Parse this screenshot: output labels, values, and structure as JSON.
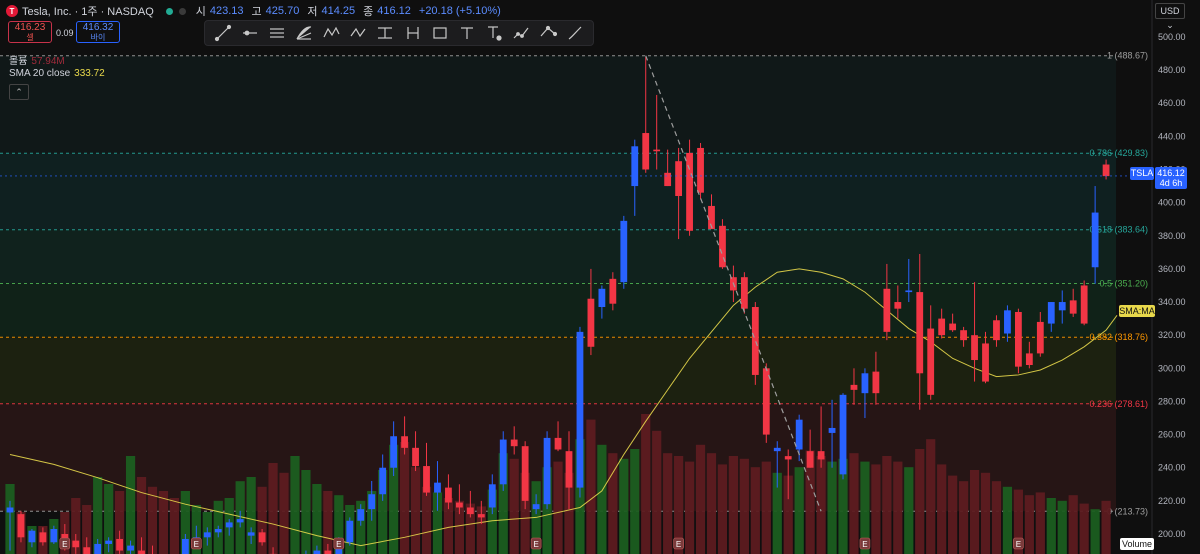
{
  "header": {
    "logo_letter": "T",
    "symbol": "Tesla, Inc. · 1주 · NASDAQ",
    "open_label": "시",
    "open": "423.13",
    "high_label": "고",
    "high": "425.70",
    "low_label": "저",
    "low": "414.25",
    "close_label": "종",
    "close": "416.12",
    "change": "+20.18 (+5.10%)",
    "sell_price": "416.23",
    "sell_label": "셀",
    "buy_price": "416.32",
    "buy_label": "바이",
    "spread": "0.09",
    "volume_label": "볼륨",
    "volume_value": "57.94M",
    "sma_label": "SMA 20 close",
    "sma_value": "333.72",
    "currency": "USD"
  },
  "toolbar": [
    "trend-line-icon",
    "ray-icon",
    "parallel-channel-icon",
    "fib-fan-icon",
    "xabcd-pattern-icon",
    "abcd-pattern-icon",
    "price-range-icon",
    "date-range-icon",
    "rectangle-icon",
    "text-icon",
    "anchored-note-icon",
    "projection-icon",
    "path-icon",
    "brush-icon"
  ],
  "price_tags": {
    "symbol_tag": "TSLA",
    "last_price": "416.12",
    "countdown": "4d 6h",
    "sma_tag": "SMA:MA",
    "volume_tag": "Volume"
  },
  "colors": {
    "up": "#2962ff",
    "down": "#f23645",
    "sma": "#e8d84b",
    "vol_up": "#1b5e20",
    "vol_down": "#5d1b20"
  },
  "chart_data": {
    "type": "candlestick",
    "interval": "1W",
    "ylim": [
      200,
      506
    ],
    "y_ticks": [
      200,
      220,
      240,
      260,
      280,
      300,
      320,
      340,
      360,
      380,
      400,
      420,
      440,
      460,
      480,
      500
    ],
    "fib_levels": [
      {
        "label": "1 (488.67)",
        "value": 488.67,
        "color": "#9e9e9e"
      },
      {
        "label": "0.786 (429.83)",
        "value": 429.83,
        "color": "#26a69a"
      },
      {
        "label": "0.618 (383.64)",
        "value": 383.64,
        "color": "#26a69a"
      },
      {
        "label": "0.5 (351.20)",
        "value": 351.2,
        "color": "#4caf50"
      },
      {
        "label": "0.382 (318.76)",
        "value": 318.76,
        "color": "#ff9800"
      },
      {
        "label": "0.236 (278.61)",
        "value": 278.61,
        "color": "#f23645"
      },
      {
        "label": "0 (213.73)",
        "value": 213.73,
        "color": "#9e9e9e"
      }
    ],
    "candles": [
      {
        "o": 213,
        "h": 220,
        "l": 190,
        "c": 216
      },
      {
        "o": 212,
        "h": 214,
        "l": 195,
        "c": 198
      },
      {
        "o": 195,
        "h": 203,
        "l": 192,
        "c": 202
      },
      {
        "o": 201,
        "h": 204,
        "l": 193,
        "c": 195
      },
      {
        "o": 195,
        "h": 205,
        "l": 194,
        "c": 203
      },
      {
        "o": 200,
        "h": 206,
        "l": 190,
        "c": 197
      },
      {
        "o": 196,
        "h": 200,
        "l": 188,
        "c": 192
      },
      {
        "o": 192,
        "h": 198,
        "l": 183,
        "c": 186
      },
      {
        "o": 187,
        "h": 197,
        "l": 184,
        "c": 194
      },
      {
        "o": 194,
        "h": 198,
        "l": 189,
        "c": 196
      },
      {
        "o": 197,
        "h": 202,
        "l": 188,
        "c": 190
      },
      {
        "o": 190,
        "h": 196,
        "l": 185,
        "c": 193
      },
      {
        "o": 190,
        "h": 198,
        "l": 182,
        "c": 185
      },
      {
        "o": 185,
        "h": 193,
        "l": 178,
        "c": 183
      },
      {
        "o": 183,
        "h": 187,
        "l": 179,
        "c": 180
      },
      {
        "o": 180,
        "h": 184,
        "l": 175,
        "c": 178
      },
      {
        "o": 186,
        "h": 200,
        "l": 182,
        "c": 197
      },
      {
        "o": 196,
        "h": 205,
        "l": 194,
        "c": 198
      },
      {
        "o": 198,
        "h": 204,
        "l": 193,
        "c": 201
      },
      {
        "o": 201,
        "h": 205,
        "l": 198,
        "c": 203
      },
      {
        "o": 204,
        "h": 209,
        "l": 199,
        "c": 207
      },
      {
        "o": 207,
        "h": 214,
        "l": 204,
        "c": 209
      },
      {
        "o": 199,
        "h": 204,
        "l": 194,
        "c": 201
      },
      {
        "o": 201,
        "h": 203,
        "l": 193,
        "c": 195
      },
      {
        "o": 188,
        "h": 192,
        "l": 178,
        "c": 181
      },
      {
        "o": 182,
        "h": 186,
        "l": 175,
        "c": 177
      },
      {
        "o": 180,
        "h": 187,
        "l": 176,
        "c": 184
      },
      {
        "o": 184,
        "h": 190,
        "l": 181,
        "c": 186
      },
      {
        "o": 186,
        "h": 193,
        "l": 183,
        "c": 190
      },
      {
        "o": 190,
        "h": 194,
        "l": 182,
        "c": 185
      },
      {
        "o": 186,
        "h": 198,
        "l": 183,
        "c": 195
      },
      {
        "o": 195,
        "h": 210,
        "l": 193,
        "c": 208
      },
      {
        "o": 208,
        "h": 218,
        "l": 205,
        "c": 215
      },
      {
        "o": 215,
        "h": 232,
        "l": 208,
        "c": 224
      },
      {
        "o": 224,
        "h": 248,
        "l": 220,
        "c": 240
      },
      {
        "o": 240,
        "h": 268,
        "l": 235,
        "c": 259
      },
      {
        "o": 259,
        "h": 271,
        "l": 248,
        "c": 252
      },
      {
        "o": 252,
        "h": 262,
        "l": 238,
        "c": 241
      },
      {
        "o": 241,
        "h": 255,
        "l": 223,
        "c": 225
      },
      {
        "o": 225,
        "h": 244,
        "l": 214,
        "c": 231
      },
      {
        "o": 228,
        "h": 236,
        "l": 215,
        "c": 219
      },
      {
        "o": 219,
        "h": 230,
        "l": 212,
        "c": 216
      },
      {
        "o": 216,
        "h": 226,
        "l": 210,
        "c": 212
      },
      {
        "o": 212,
        "h": 220,
        "l": 206,
        "c": 210
      },
      {
        "o": 216,
        "h": 236,
        "l": 212,
        "c": 230
      },
      {
        "o": 230,
        "h": 262,
        "l": 226,
        "c": 257
      },
      {
        "o": 257,
        "h": 265,
        "l": 248,
        "c": 253
      },
      {
        "o": 253,
        "h": 256,
        "l": 215,
        "c": 220
      },
      {
        "o": 215,
        "h": 224,
        "l": 212,
        "c": 218
      },
      {
        "o": 218,
        "h": 262,
        "l": 215,
        "c": 258
      },
      {
        "o": 258,
        "h": 268,
        "l": 250,
        "c": 251
      },
      {
        "o": 250,
        "h": 262,
        "l": 215,
        "c": 228
      },
      {
        "o": 228,
        "h": 325,
        "l": 222,
        "c": 322
      },
      {
        "o": 342,
        "h": 360,
        "l": 308,
        "c": 313
      },
      {
        "o": 337,
        "h": 350,
        "l": 330,
        "c": 348
      },
      {
        "o": 354,
        "h": 358,
        "l": 335,
        "c": 339
      },
      {
        "o": 352,
        "h": 392,
        "l": 348,
        "c": 389
      },
      {
        "o": 410,
        "h": 438,
        "l": 392,
        "c": 434
      },
      {
        "o": 442,
        "h": 488,
        "l": 418,
        "c": 420
      },
      {
        "o": 432,
        "h": 465,
        "l": 420,
        "c": 431
      },
      {
        "o": 418,
        "h": 432,
        "l": 410,
        "c": 410
      },
      {
        "o": 425,
        "h": 433,
        "l": 378,
        "c": 404
      },
      {
        "o": 430,
        "h": 438,
        "l": 380,
        "c": 383
      },
      {
        "o": 433,
        "h": 436,
        "l": 402,
        "c": 406
      },
      {
        "o": 398,
        "h": 405,
        "l": 385,
        "c": 384
      },
      {
        "o": 386,
        "h": 390,
        "l": 360,
        "c": 361
      },
      {
        "o": 355,
        "h": 362,
        "l": 340,
        "c": 347
      },
      {
        "o": 355,
        "h": 358,
        "l": 333,
        "c": 336
      },
      {
        "o": 337,
        "h": 340,
        "l": 290,
        "c": 296
      },
      {
        "o": 300,
        "h": 303,
        "l": 255,
        "c": 260
      },
      {
        "o": 250,
        "h": 256,
        "l": 228,
        "c": 252
      },
      {
        "o": 247,
        "h": 251,
        "l": 221,
        "c": 245
      },
      {
        "o": 251,
        "h": 272,
        "l": 244,
        "c": 269
      },
      {
        "o": 250,
        "h": 263,
        "l": 240,
        "c": 240
      },
      {
        "o": 250,
        "h": 277,
        "l": 240,
        "c": 245
      },
      {
        "o": 261,
        "h": 281,
        "l": 240,
        "c": 264
      },
      {
        "o": 236,
        "h": 285,
        "l": 233,
        "c": 284
      },
      {
        "o": 290,
        "h": 300,
        "l": 278,
        "c": 287
      },
      {
        "o": 285,
        "h": 300,
        "l": 270,
        "c": 297
      },
      {
        "o": 298,
        "h": 310,
        "l": 278,
        "c": 285
      },
      {
        "o": 348,
        "h": 363,
        "l": 317,
        "c": 322
      },
      {
        "o": 340,
        "h": 350,
        "l": 330,
        "c": 336
      },
      {
        "o": 346,
        "h": 366,
        "l": 340,
        "c": 347
      },
      {
        "o": 346,
        "h": 369,
        "l": 275,
        "c": 297
      },
      {
        "o": 324,
        "h": 338,
        "l": 281,
        "c": 284
      },
      {
        "o": 330,
        "h": 336,
        "l": 318,
        "c": 320
      },
      {
        "o": 327,
        "h": 333,
        "l": 322,
        "c": 323
      },
      {
        "o": 323,
        "h": 325,
        "l": 313,
        "c": 317
      },
      {
        "o": 320,
        "h": 352,
        "l": 292,
        "c": 305
      },
      {
        "o": 315,
        "h": 322,
        "l": 291,
        "c": 292
      },
      {
        "o": 329,
        "h": 332,
        "l": 313,
        "c": 317
      },
      {
        "o": 321,
        "h": 338,
        "l": 316,
        "c": 335
      },
      {
        "o": 334,
        "h": 336,
        "l": 297,
        "c": 301
      },
      {
        "o": 309,
        "h": 316,
        "l": 300,
        "c": 302
      },
      {
        "o": 328,
        "h": 334,
        "l": 307,
        "c": 309
      },
      {
        "o": 327,
        "h": 340,
        "l": 322,
        "c": 340
      },
      {
        "o": 335,
        "h": 347,
        "l": 327,
        "c": 340
      },
      {
        "o": 341,
        "h": 348,
        "l": 331,
        "c": 333
      },
      {
        "o": 350,
        "h": 353,
        "l": 326,
        "c": 327
      },
      {
        "o": 361,
        "h": 410,
        "l": 351,
        "c": 394
      },
      {
        "o": 423,
        "h": 426,
        "l": 414,
        "c": 416
      }
    ],
    "sma": [
      {
        "i": 0,
        "v": 248
      },
      {
        "i": 4,
        "v": 242
      },
      {
        "i": 8,
        "v": 234
      },
      {
        "i": 12,
        "v": 225
      },
      {
        "i": 16,
        "v": 218
      },
      {
        "i": 20,
        "v": 212
      },
      {
        "i": 24,
        "v": 206
      },
      {
        "i": 28,
        "v": 199
      },
      {
        "i": 32,
        "v": 193
      },
      {
        "i": 36,
        "v": 198
      },
      {
        "i": 40,
        "v": 204
      },
      {
        "i": 44,
        "v": 208
      },
      {
        "i": 48,
        "v": 210
      },
      {
        "i": 52,
        "v": 216
      },
      {
        "i": 54,
        "v": 226
      },
      {
        "i": 56,
        "v": 248
      },
      {
        "i": 58,
        "v": 268
      },
      {
        "i": 60,
        "v": 287
      },
      {
        "i": 62,
        "v": 306
      },
      {
        "i": 64,
        "v": 322
      },
      {
        "i": 66,
        "v": 338
      },
      {
        "i": 68,
        "v": 349
      },
      {
        "i": 70,
        "v": 358
      },
      {
        "i": 72,
        "v": 360
      },
      {
        "i": 74,
        "v": 358
      },
      {
        "i": 76,
        "v": 354
      },
      {
        "i": 78,
        "v": 346
      },
      {
        "i": 80,
        "v": 335
      },
      {
        "i": 82,
        "v": 324
      },
      {
        "i": 84,
        "v": 316
      },
      {
        "i": 86,
        "v": 306
      },
      {
        "i": 88,
        "v": 300
      },
      {
        "i": 90,
        "v": 295
      },
      {
        "i": 92,
        "v": 296
      },
      {
        "i": 94,
        "v": 299
      },
      {
        "i": 96,
        "v": 305
      },
      {
        "i": 98,
        "v": 313
      },
      {
        "i": 100,
        "v": 323
      },
      {
        "i": 101,
        "v": 332
      }
    ],
    "volume_rel": [
      0.5,
      0.3,
      0.2,
      0.2,
      0.25,
      0.3,
      0.4,
      0.35,
      0.55,
      0.5,
      0.45,
      0.7,
      0.55,
      0.48,
      0.45,
      0.4,
      0.45,
      0.35,
      0.3,
      0.38,
      0.4,
      0.52,
      0.55,
      0.48,
      0.65,
      0.58,
      0.7,
      0.6,
      0.5,
      0.45,
      0.42,
      0.35,
      0.38,
      0.45,
      0.6,
      0.78,
      0.8,
      0.62,
      0.48,
      0.44,
      0.4,
      0.38,
      0.36,
      0.34,
      0.46,
      0.72,
      0.68,
      0.58,
      0.52,
      0.62,
      0.66,
      0.58,
      0.82,
      0.96,
      0.78,
      0.72,
      0.68,
      0.75,
      1.0,
      0.88,
      0.72,
      0.7,
      0.66,
      0.78,
      0.72,
      0.64,
      0.7,
      0.68,
      0.62,
      0.66,
      0.58,
      0.56,
      0.62,
      0.74,
      0.7,
      0.66,
      0.68,
      0.72,
      0.66,
      0.64,
      0.7,
      0.66,
      0.62,
      0.75,
      0.82,
      0.64,
      0.56,
      0.52,
      0.6,
      0.58,
      0.52,
      0.48,
      0.46,
      0.42,
      0.44,
      0.4,
      0.38,
      0.42,
      0.36,
      0.32,
      0.38,
      0.48
    ],
    "earnings_markers": [
      5,
      17,
      30,
      48,
      61,
      78,
      92
    ],
    "x_count": 102
  }
}
